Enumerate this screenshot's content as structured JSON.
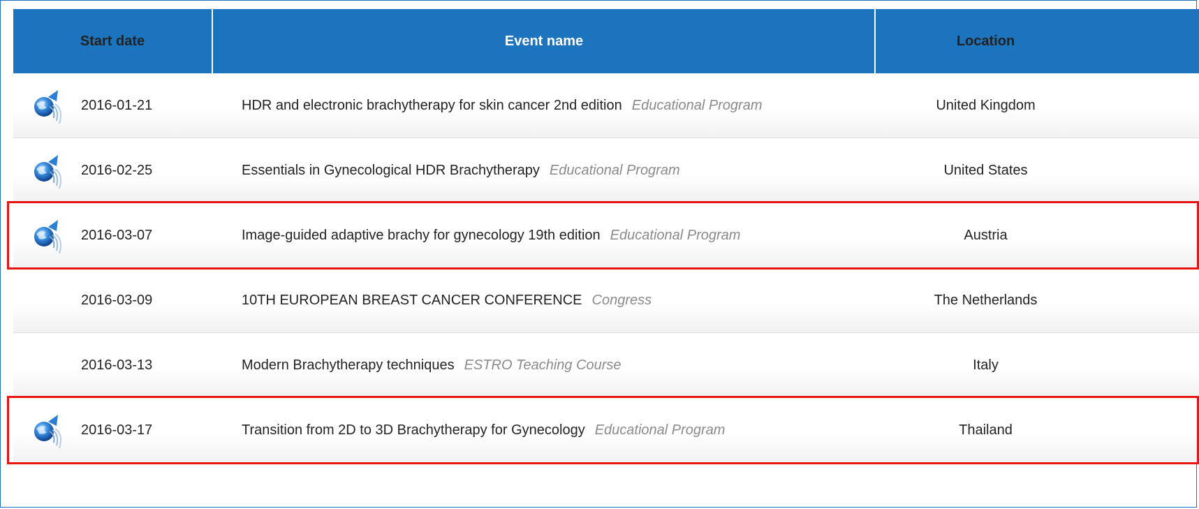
{
  "header": {
    "start_date": "Start date",
    "event_name": "Event name",
    "location": "Location"
  },
  "rows": [
    {
      "icon": "globe-broadcast-icon",
      "date": "2016-01-21",
      "name": "HDR and electronic brachytherapy for skin cancer 2nd edition",
      "type": "Educational Program",
      "location": "United Kingdom",
      "highlighted": false
    },
    {
      "icon": "globe-broadcast-icon",
      "date": "2016-02-25",
      "name": "Essentials in Gynecological HDR Brachytherapy",
      "type": "Educational Program",
      "location": "United States",
      "highlighted": false
    },
    {
      "icon": "globe-broadcast-icon",
      "date": "2016-03-07",
      "name": "Image-guided adaptive brachy for gynecology 19th edition",
      "type": "Educational Program",
      "location": "Austria",
      "highlighted": true
    },
    {
      "icon": "",
      "date": "2016-03-09",
      "name": "10TH EUROPEAN BREAST CANCER CONFERENCE",
      "type": "Congress",
      "location": "The Netherlands",
      "highlighted": false
    },
    {
      "icon": "",
      "date": "2016-03-13",
      "name": "Modern Brachytherapy techniques",
      "type": "ESTRO Teaching Course",
      "location": "Italy",
      "highlighted": false
    },
    {
      "icon": "globe-broadcast-icon",
      "date": "2016-03-17",
      "name": "Transition from 2D to 3D Brachytherapy for Gynecology",
      "type": "Educational Program",
      "location": "Thailand",
      "highlighted": true
    }
  ],
  "colors": {
    "header_bg": "#1c73be",
    "highlight_border": "#e81414",
    "event_type_text": "#8a8a8a"
  }
}
